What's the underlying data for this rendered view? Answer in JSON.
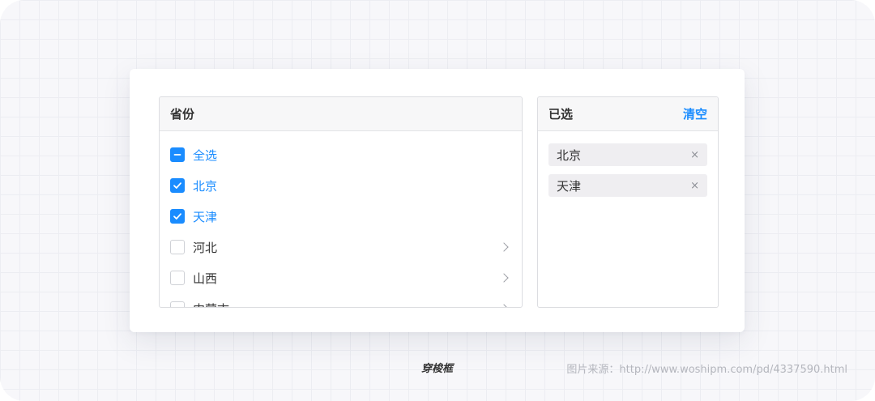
{
  "source_panel": {
    "title": "省份",
    "items": [
      {
        "label": "全选",
        "state": "indeterminate",
        "active": true,
        "expandable": false
      },
      {
        "label": "北京",
        "state": "checked",
        "active": true,
        "expandable": false
      },
      {
        "label": "天津",
        "state": "checked",
        "active": true,
        "expandable": false
      },
      {
        "label": "河北",
        "state": "unchecked",
        "active": false,
        "expandable": true
      },
      {
        "label": "山西",
        "state": "unchecked",
        "active": false,
        "expandable": true
      },
      {
        "label": "内蒙古",
        "state": "unchecked",
        "active": false,
        "expandable": true
      }
    ]
  },
  "target_panel": {
    "title": "已选",
    "clear_label": "清空",
    "tags": [
      {
        "label": "北京",
        "close_glyph": "×"
      },
      {
        "label": "天津",
        "close_glyph": "×"
      }
    ]
  },
  "caption": "穿梭框",
  "source_note": "图片来源：http://www.woshipm.com/pd/4337590.html",
  "colors": {
    "accent": "#1a8cff",
    "text": "#333333",
    "border": "#dcdde1",
    "tag_bg": "#efeef1"
  }
}
